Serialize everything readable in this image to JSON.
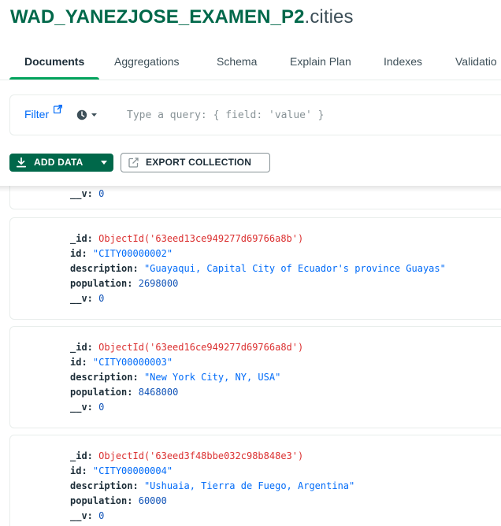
{
  "header": {
    "db_name": "WAD_YANEZJOSE_EXAMEN_P2",
    "collection_suffix": ".cities"
  },
  "tabs": [
    {
      "label": "Documents",
      "active": true
    },
    {
      "label": "Aggregations",
      "active": false
    },
    {
      "label": "Schema",
      "active": false
    },
    {
      "label": "Explain Plan",
      "active": false
    },
    {
      "label": "Indexes",
      "active": false
    },
    {
      "label": "Validatio",
      "active": false
    }
  ],
  "filter": {
    "label": "Filter",
    "icons": [
      "external-link-icon",
      "clock-history-icon",
      "caret-down-icon"
    ],
    "placeholder": "Type a query: { field: 'value' }"
  },
  "toolbar": {
    "add_data_label": "ADD DATA",
    "add_data_icon": "download-icon",
    "export_label": "EXPORT COLLECTION",
    "export_icon": "export-icon"
  },
  "documents": [
    {
      "partial": true,
      "v_key": "__v:",
      "v_value": "0"
    },
    {
      "id_key": "_id:",
      "object_id": "ObjectId('63eed13ce949277d69766a8b')",
      "id_field_key": "id:",
      "id_value": "\"CITY00000002\"",
      "description_key": "description:",
      "description": "\"Guayaqui, Capital City of Ecuador's province Guayas\"",
      "population_key": "population:",
      "population": "2698000",
      "v_key": "__v:",
      "v_value": "0"
    },
    {
      "id_key": "_id:",
      "object_id": "ObjectId('63eed16ce949277d69766a8d')",
      "id_field_key": "id:",
      "id_value": "\"CITY00000003\"",
      "description_key": "description:",
      "description": "\"New York City, NY, USA\"",
      "population_key": "population:",
      "population": "8468000",
      "v_key": "__v:",
      "v_value": "0"
    },
    {
      "id_key": "_id:",
      "object_id": "ObjectId('63eed3f48bbe032c98b848e3')",
      "id_field_key": "id:",
      "id_value": "\"CITY00000004\"",
      "description_key": "description:",
      "description": "\"Ushuaia, Tierra de Fuego, Argentina\"",
      "population_key": "population:",
      "population": "60000",
      "v_key": "__v:",
      "v_value": "0"
    }
  ],
  "colors": {
    "brand_green": "#00684a",
    "tab_active_underline": "#00a35c",
    "link_blue": "#016bf8",
    "object_id_red": "#db3030",
    "number_blue": "#1254b7",
    "border": "#e8edeb"
  }
}
